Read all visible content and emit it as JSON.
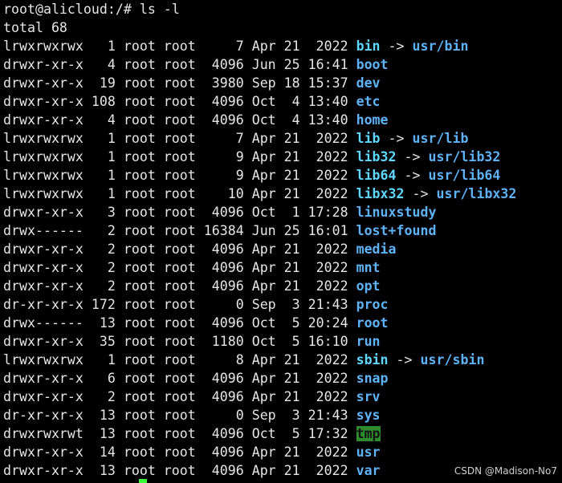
{
  "terminal": {
    "prompt": "root@alicloud:/#",
    "command": "ls -l",
    "total": "total 68",
    "rows": [
      {
        "meta": "lrwxrwxrwx   1 root root     7 Apr 21  2022 ",
        "name": "bin",
        "kind": "link",
        "target": "usr/bin"
      },
      {
        "meta": "drwxr-xr-x   4 root root  4096 Jun 25 16:41 ",
        "name": "boot",
        "kind": "dir"
      },
      {
        "meta": "drwxr-xr-x  19 root root  3980 Sep 18 15:37 ",
        "name": "dev",
        "kind": "dir"
      },
      {
        "meta": "drwxr-xr-x 108 root root  4096 Oct  4 13:40 ",
        "name": "etc",
        "kind": "dir"
      },
      {
        "meta": "drwxr-xr-x   4 root root  4096 Oct  4 13:40 ",
        "name": "home",
        "kind": "dir"
      },
      {
        "meta": "lrwxrwxrwx   1 root root     7 Apr 21  2022 ",
        "name": "lib",
        "kind": "link",
        "target": "usr/lib"
      },
      {
        "meta": "lrwxrwxrwx   1 root root     9 Apr 21  2022 ",
        "name": "lib32",
        "kind": "link",
        "target": "usr/lib32"
      },
      {
        "meta": "lrwxrwxrwx   1 root root     9 Apr 21  2022 ",
        "name": "lib64",
        "kind": "link",
        "target": "usr/lib64"
      },
      {
        "meta": "lrwxrwxrwx   1 root root    10 Apr 21  2022 ",
        "name": "libx32",
        "kind": "link",
        "target": "usr/libx32"
      },
      {
        "meta": "drwxr-xr-x   3 root root  4096 Oct  1 17:28 ",
        "name": "linuxstudy",
        "kind": "dir"
      },
      {
        "meta": "drwx------   2 root root 16384 Jun 25 16:01 ",
        "name": "lost+found",
        "kind": "dir"
      },
      {
        "meta": "drwxr-xr-x   2 root root  4096 Apr 21  2022 ",
        "name": "media",
        "kind": "dir"
      },
      {
        "meta": "drwxr-xr-x   2 root root  4096 Apr 21  2022 ",
        "name": "mnt",
        "kind": "dir"
      },
      {
        "meta": "drwxr-xr-x   2 root root  4096 Apr 21  2022 ",
        "name": "opt",
        "kind": "dir"
      },
      {
        "meta": "dr-xr-xr-x 172 root root     0 Sep  3 21:43 ",
        "name": "proc",
        "kind": "dir"
      },
      {
        "meta": "drwx------  13 root root  4096 Oct  5 20:24 ",
        "name": "root",
        "kind": "dir"
      },
      {
        "meta": "drwxr-xr-x  35 root root  1180 Oct  5 16:10 ",
        "name": "run",
        "kind": "dir"
      },
      {
        "meta": "lrwxrwxrwx   1 root root     8 Apr 21  2022 ",
        "name": "sbin",
        "kind": "link",
        "target": "usr/sbin"
      },
      {
        "meta": "drwxr-xr-x   6 root root  4096 Apr 21  2022 ",
        "name": "snap",
        "kind": "dir"
      },
      {
        "meta": "drwxr-xr-x   2 root root  4096 Apr 21  2022 ",
        "name": "srv",
        "kind": "dir"
      },
      {
        "meta": "dr-xr-xr-x  13 root root     0 Sep  3 21:43 ",
        "name": "sys",
        "kind": "dir"
      },
      {
        "meta": "drwxrwxrwt  13 root root  4096 Oct  5 17:32 ",
        "name": "tmp",
        "kind": "sticky"
      },
      {
        "meta": "drwxr-xr-x  14 root root  4096 Apr 21  2022 ",
        "name": "usr",
        "kind": "dir"
      },
      {
        "meta": "drwxr-xr-x  13 root root  4096 Apr 21  2022 ",
        "name": "var",
        "kind": "dir"
      }
    ],
    "arrow": " -> ",
    "watermark": "CSDN @Madison-No7"
  },
  "colors": {
    "background": "#000000",
    "text": "#e6e6e6",
    "directory": "#5fb2f7",
    "symlink": "#5fd7ff",
    "sticky_bg": "#2e8b2e",
    "cursor": "#3cff3c"
  }
}
